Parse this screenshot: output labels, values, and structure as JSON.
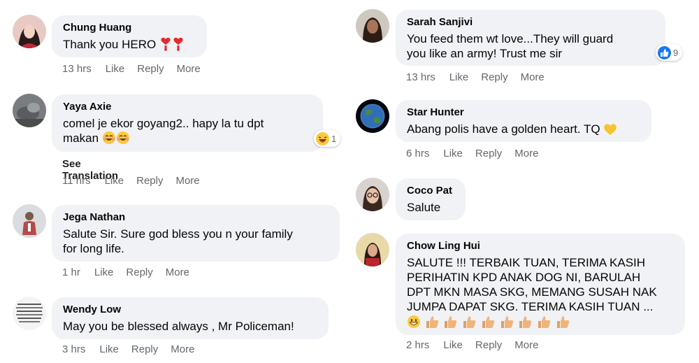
{
  "colors": {
    "bubble": "#f0f2f5",
    "meta": "#65676b",
    "like_blue": "#1877f2"
  },
  "comments": [
    {
      "name": "Chung Huang",
      "text": "Thank you HERO",
      "time": "13 hrs",
      "like": "Like",
      "reply": "Reply",
      "more": "More"
    },
    {
      "name": "Yaya Axie",
      "line1": "comel je ekor goyang2.. hapy la tu dpt",
      "line2": "makan",
      "see_translation": "See Translation",
      "time": "11 hrs",
      "like": "Like",
      "reply": "Reply",
      "more": "More",
      "reaction_count": "1",
      "reaction_icon": "laughing-emoji"
    },
    {
      "name": "Jega Nathan",
      "line1": "Salute Sir. Sure god bless you n your family",
      "line2": "for long life.",
      "time": "1 hr",
      "like": "Like",
      "reply": "Reply",
      "more": "More"
    },
    {
      "name": "Wendy Low",
      "text": "May you be blessed always , Mr Policeman!",
      "time": "3 hrs",
      "like": "Like",
      "reply": "Reply",
      "more": "More"
    },
    {
      "name": "Sarah Sanjivi",
      "line1": "You feed them wt love...They will guard",
      "line2": "you like an army! Trust me sir",
      "time": "13 hrs",
      "like": "Like",
      "reply": "Reply",
      "more": "More",
      "reaction_count": "9",
      "reaction_icon": "thumbs-up"
    },
    {
      "name": "Star Hunter",
      "text": "Abang polis have a golden heart. TQ",
      "time": "6 hrs",
      "like": "Like",
      "reply": "Reply",
      "more": "More"
    },
    {
      "name": "Coco Pat",
      "text": "Salute"
    },
    {
      "name": "Chow Ling Hui",
      "line1": "SALUTE !!! TERBAIK TUAN, TERIMA KASIH",
      "line2": "PERIHATIN KPD ANAK DOG NI, BARULAH",
      "line3": "DPT MKN MASA SKG, MEMANG SUSAH NAK",
      "line4": "JUMPA DAPAT SKG. TERIMA KASIH TUAN ...",
      "time": "2 hrs",
      "like": "Like",
      "reply": "Reply",
      "more": "More"
    }
  ]
}
